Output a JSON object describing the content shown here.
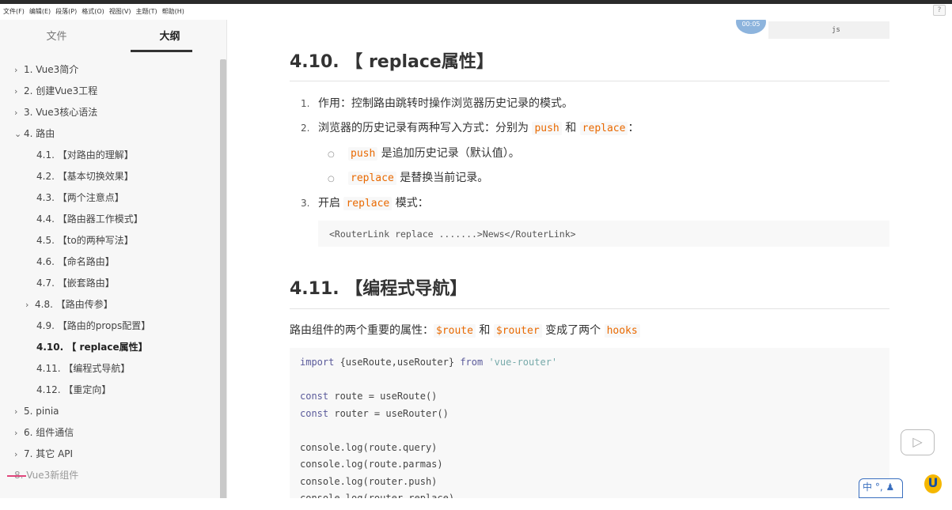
{
  "menu": [
    "文件(F)",
    "编辑(E)",
    "段落(P)",
    "格式(O)",
    "视图(V)",
    "主题(T)",
    "帮助(H)"
  ],
  "help_icon": "?",
  "sidebar": {
    "tabs": [
      "文件",
      "大纲"
    ],
    "items": [
      {
        "label": "1. Vue3简介",
        "level": 1,
        "arrow": "›"
      },
      {
        "label": "2. 创建Vue3工程",
        "level": 1,
        "arrow": "›"
      },
      {
        "label": "3. Vue3核心语法",
        "level": 1,
        "arrow": "›"
      },
      {
        "label": "4. 路由",
        "level": 1,
        "arrow": "⌄"
      },
      {
        "label": "4.1. 【对路由的理解】",
        "level": 2
      },
      {
        "label": "4.2. 【基本切换效果】",
        "level": 2
      },
      {
        "label": "4.3. 【两个注意点】",
        "level": 2
      },
      {
        "label": "4.4. 【路由器工作模式】",
        "level": 2
      },
      {
        "label": "4.5. 【to的两种写法】",
        "level": 2
      },
      {
        "label": "4.6. 【命名路由】",
        "level": 2
      },
      {
        "label": "4.7. 【嵌套路由】",
        "level": 2
      },
      {
        "label": "4.8. 【路由传参】",
        "level": 2,
        "arrow": "›"
      },
      {
        "label": "4.9. 【路由的props配置】",
        "level": 2
      },
      {
        "label": "4.10. 【 replace属性】",
        "level": 2,
        "current": true
      },
      {
        "label": "4.11. 【编程式导航】",
        "level": 2
      },
      {
        "label": "4.12. 【重定向】",
        "level": 2
      },
      {
        "label": "5. pinia",
        "level": 1,
        "arrow": "›"
      },
      {
        "label": "6. 组件通信",
        "level": 1,
        "arrow": "›"
      },
      {
        "label": "7. 其它 API",
        "level": 1,
        "arrow": "›"
      },
      {
        "label": "8. Vue3新组件",
        "level": 1,
        "faded": true
      }
    ]
  },
  "overlay": {
    "timer": "00:05",
    "lang_label": "js"
  },
  "content": {
    "h_replace": "4.10. 【 replace属性】",
    "list": [
      {
        "n": "1.",
        "text": "作用：控制路由跳转时操作浏览器历史记录的模式。"
      },
      {
        "n": "2.",
        "text_a": "浏览器的历史记录有两种写入方式：分别为 ",
        "code_a": "push",
        "text_b": " 和 ",
        "code_b": "replace",
        "text_c": "："
      },
      {
        "n": "3.",
        "text_a": "开启 ",
        "code_a": "replace",
        "text_b": " 模式："
      }
    ],
    "sub": [
      {
        "code": "push",
        "text": " 是追加历史记录（默认值）。"
      },
      {
        "code": "replace",
        "text": " 是替换当前记录。"
      }
    ],
    "code1": "<RouterLink replace .......>News</RouterLink>",
    "h_nav": "4.11. 【编程式导航】",
    "nav_para": {
      "a": "路由组件的两个重要的属性：",
      "code_a": "$route",
      "b": " 和 ",
      "code_b": "$router",
      "c": " 变成了两个 ",
      "code_c": "hooks"
    },
    "code2": [
      {
        "kw": "import",
        "rest": " {useRoute,useRouter} ",
        "kw2": "from",
        "str": " 'vue-router'"
      },
      {
        "plain": ""
      },
      {
        "kw": "const",
        "rest": " route = useRoute()"
      },
      {
        "kw": "const",
        "rest": " router = useRouter()"
      },
      {
        "plain": ""
      },
      {
        "plain": "console.log(route.query)"
      },
      {
        "plain": "console.log(route.parmas)"
      },
      {
        "plain": "console.log(router.push)"
      },
      {
        "plain": "console.log(router.replace)"
      }
    ]
  },
  "widgets": {
    "play_icon": "▷",
    "ime_text": "中 °, ♟",
    "logo": "U"
  }
}
